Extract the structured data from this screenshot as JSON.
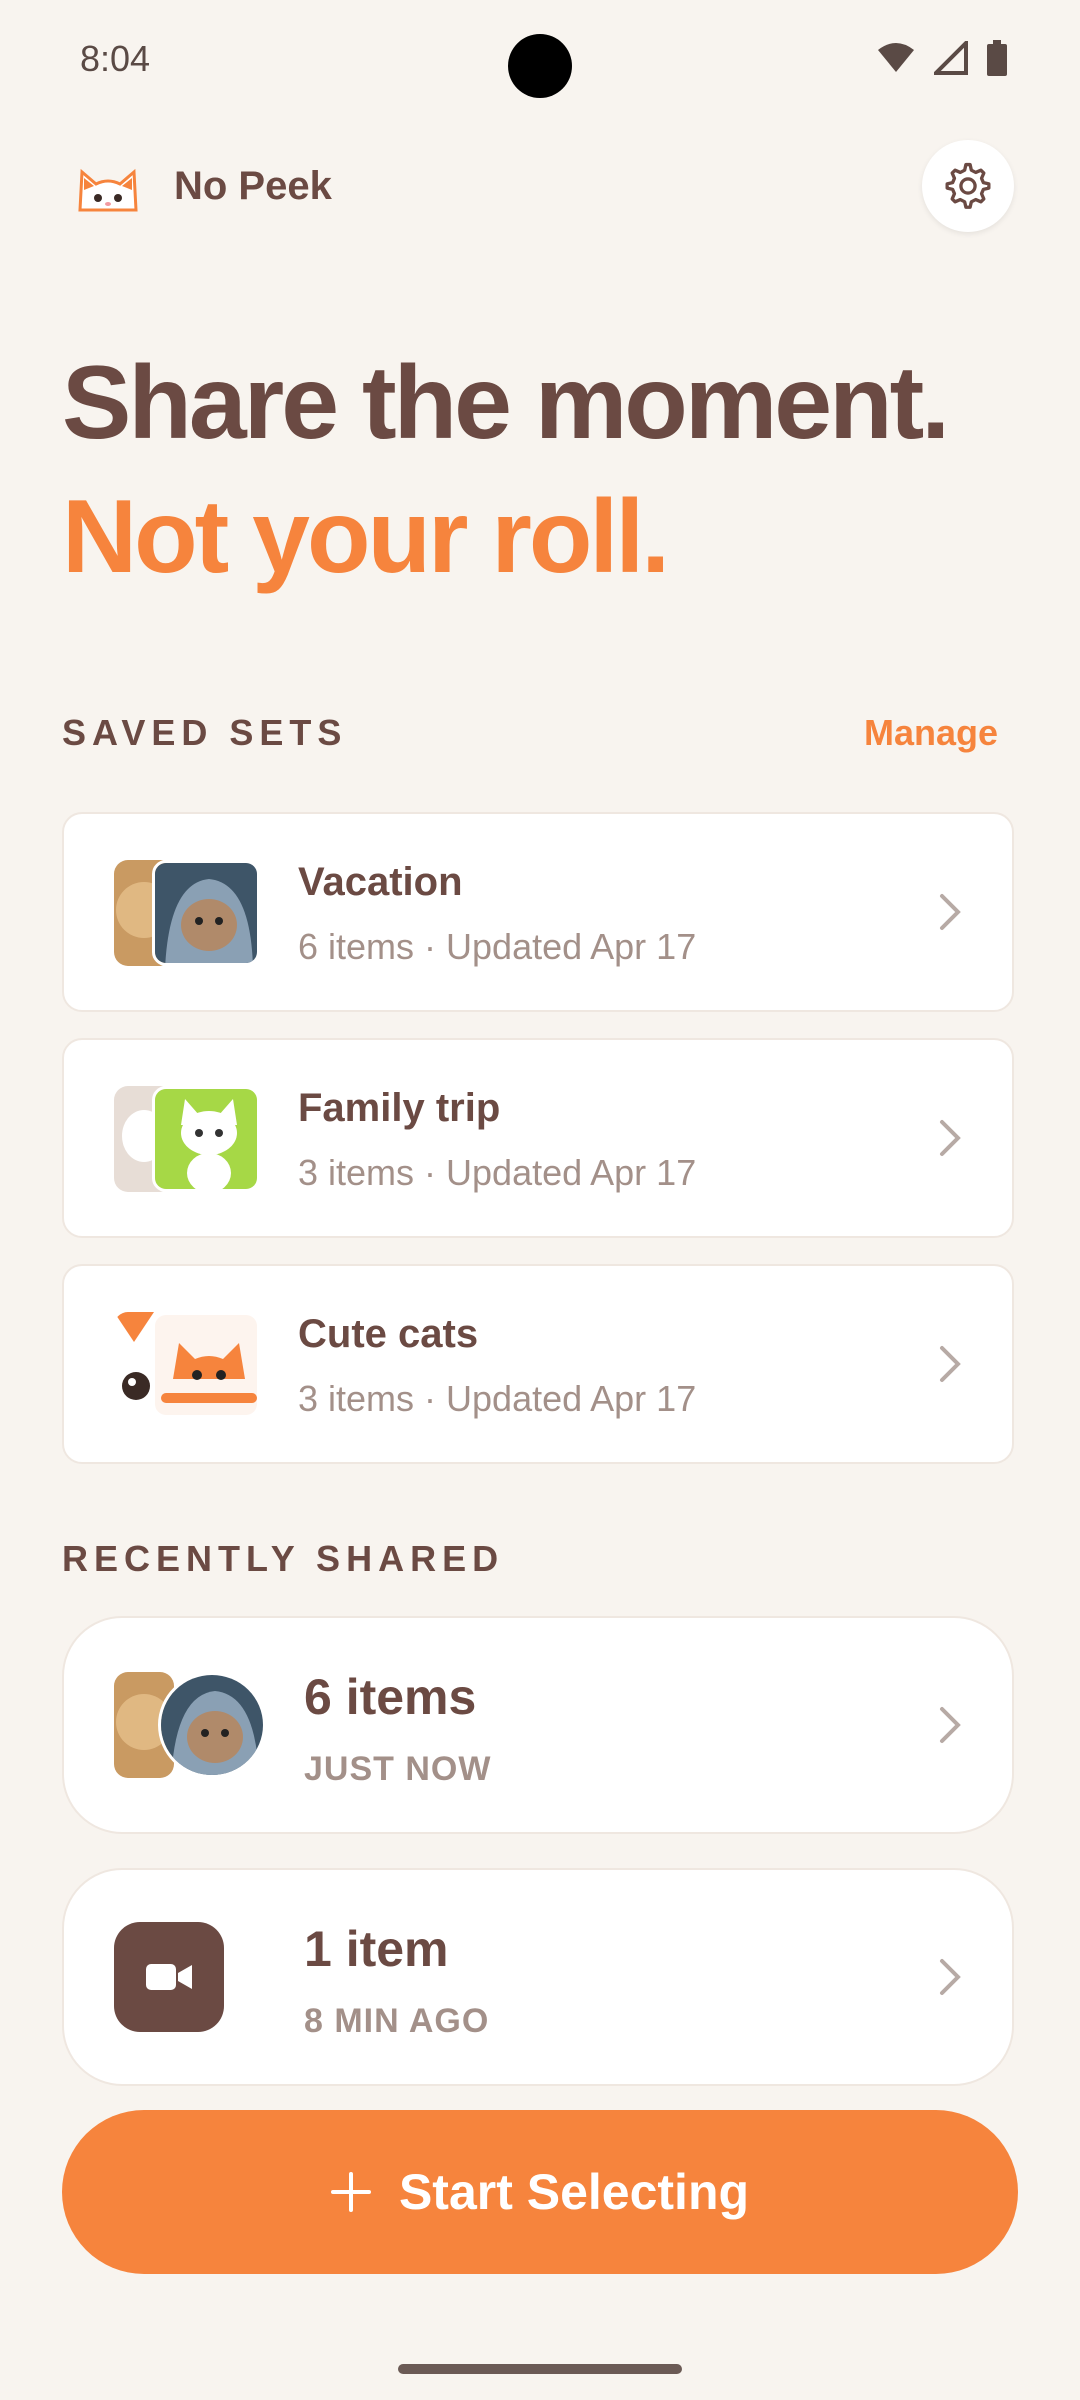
{
  "status_bar": {
    "time": "8:04"
  },
  "header": {
    "app_name": "No Peek"
  },
  "hero": {
    "line1": "Share the moment.",
    "line2": "Not your roll."
  },
  "saved_sets": {
    "section_title": "SAVED SETS",
    "manage_label": "Manage",
    "items": [
      {
        "title": "Vacation",
        "meta": "6 items · Updated Apr 17"
      },
      {
        "title": "Family trip",
        "meta": "3 items · Updated Apr 17"
      },
      {
        "title": "Cute cats",
        "meta": "3 items · Updated Apr 17"
      }
    ]
  },
  "recently_shared": {
    "section_title": "RECENTLY SHARED",
    "items": [
      {
        "title": "6 items",
        "time": "JUST NOW"
      },
      {
        "title": "1 item",
        "time": "8 MIN AGO"
      }
    ]
  },
  "cta": {
    "label": "Start Selecting"
  },
  "colors": {
    "background": "#f8f4ef",
    "text_brown": "#6b4a43",
    "accent_orange": "#f6843d",
    "muted": "#a39089"
  }
}
